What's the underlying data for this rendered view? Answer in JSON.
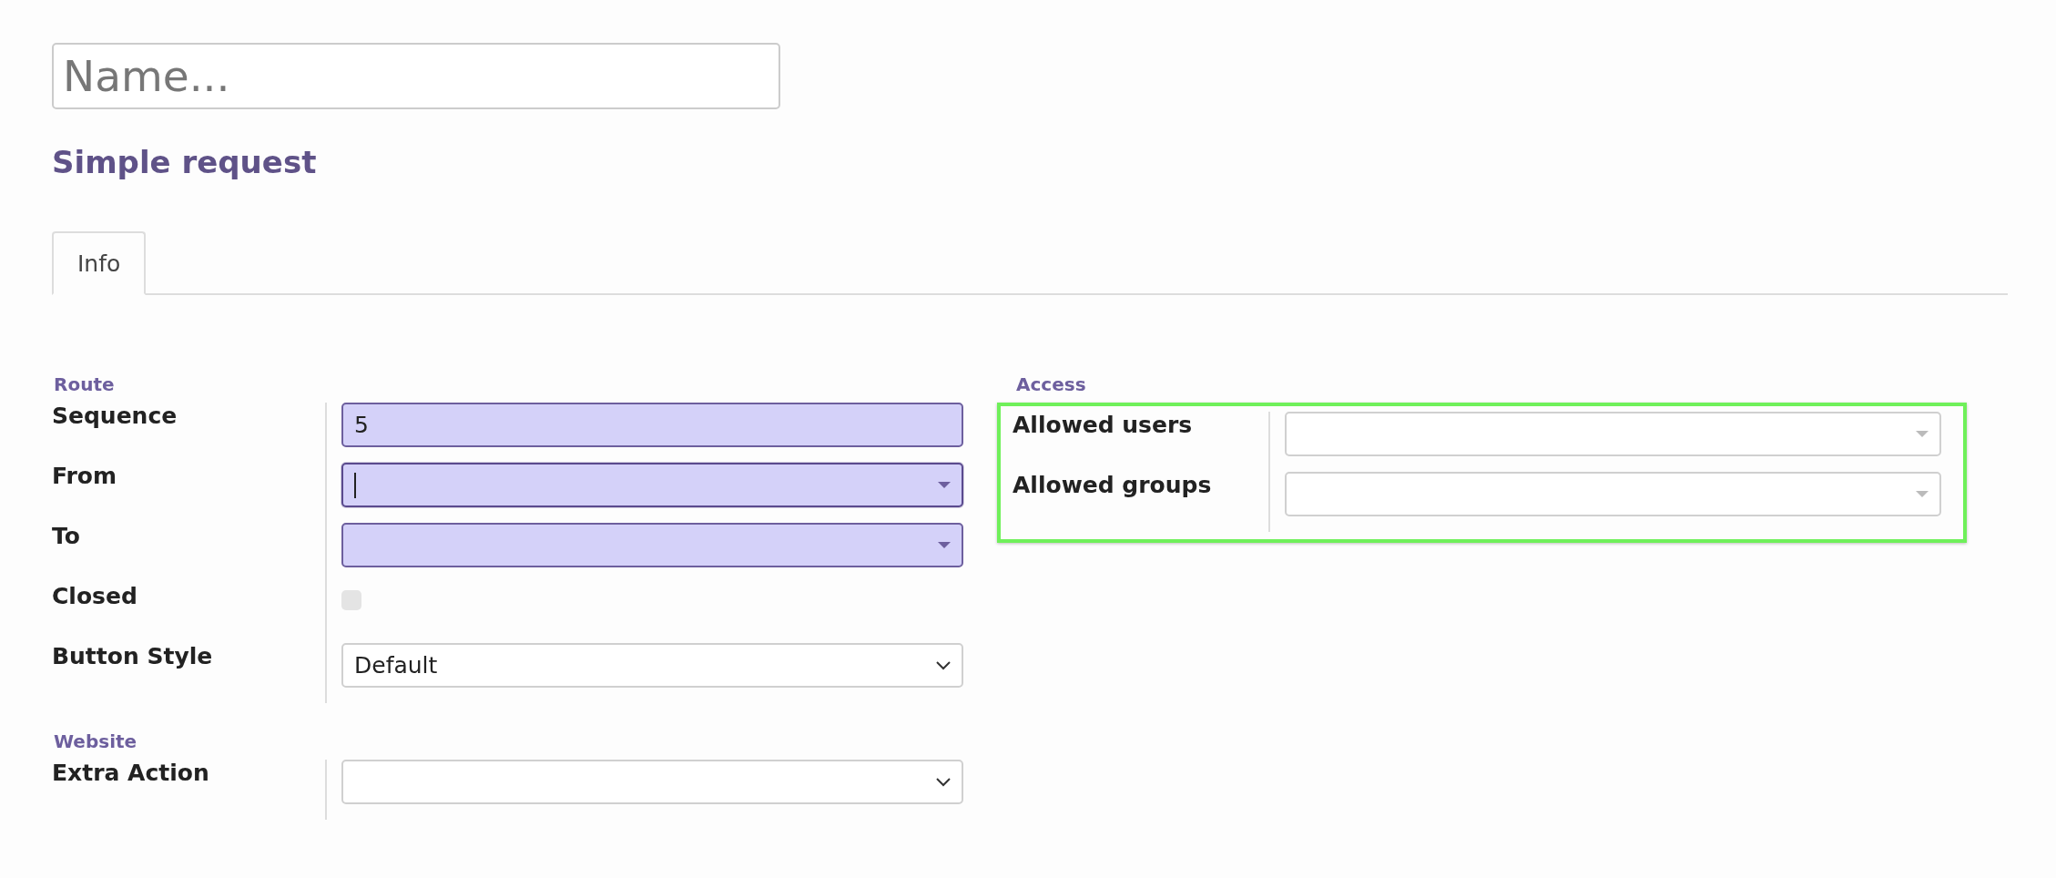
{
  "name_field": {
    "placeholder": "Name..."
  },
  "title": "Simple request",
  "tabs": [
    {
      "label": "Info",
      "selected": true
    }
  ],
  "left_column": [
    {
      "heading": "Route",
      "highlighted": false,
      "fields": [
        {
          "label": "Sequence",
          "kind": "text",
          "value": "5",
          "required": true,
          "focused": false
        },
        {
          "label": "From",
          "kind": "lookup",
          "required": true,
          "focused": true
        },
        {
          "label": "To",
          "kind": "lookup",
          "required": true,
          "focused": false
        },
        {
          "label": "Closed",
          "kind": "checkbox",
          "checked": false
        },
        {
          "label": "Button Style",
          "kind": "select",
          "value": "Default",
          "required": false,
          "focused": false
        }
      ]
    },
    {
      "heading": "Website",
      "highlighted": false,
      "fields": [
        {
          "label": "Extra Action",
          "kind": "select",
          "required": false,
          "focused": false
        }
      ]
    }
  ],
  "right_column": [
    {
      "heading": "Access",
      "highlighted": true,
      "fields": [
        {
          "label": "Allowed users",
          "kind": "lookup",
          "required": false,
          "focused": false
        },
        {
          "label": "Allowed groups",
          "kind": "lookup",
          "required": false,
          "focused": false
        }
      ]
    }
  ]
}
